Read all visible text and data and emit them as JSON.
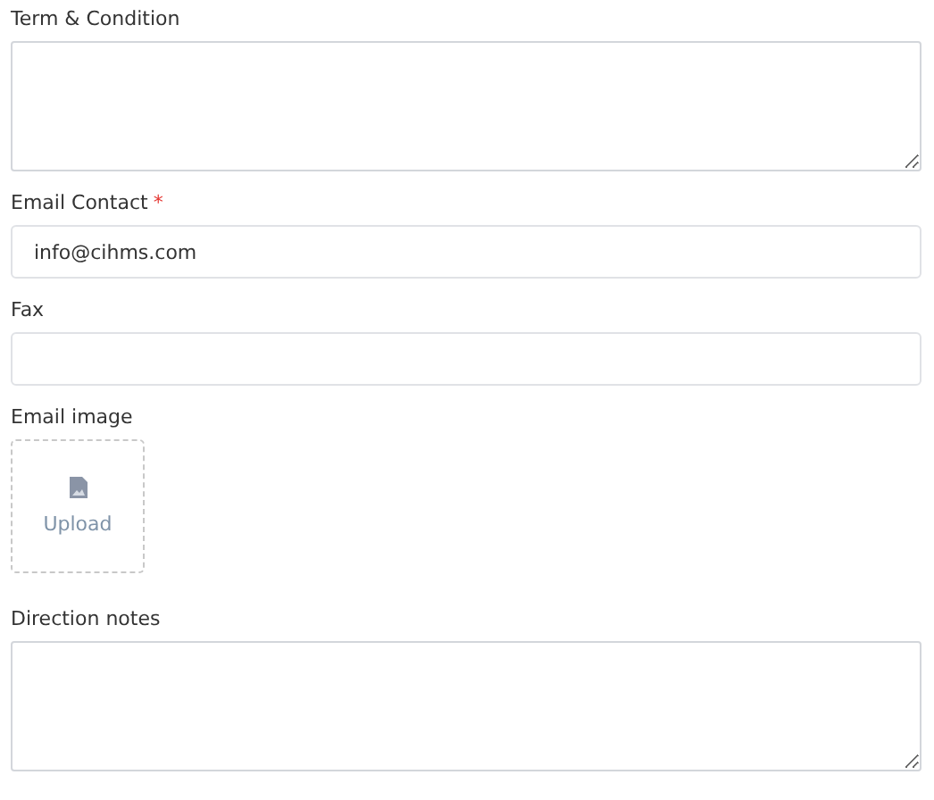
{
  "fields": [
    {
      "kind": "textarea",
      "label": "Term & Condition"
    },
    {
      "kind": "input",
      "label": "Email Contact",
      "required_mark": "*",
      "value": "info@cihms.com"
    },
    {
      "kind": "input",
      "label": "Fax"
    },
    {
      "kind": "upload",
      "label": "Email image",
      "button": "Upload"
    },
    {
      "kind": "textarea",
      "label": "Direction notes"
    }
  ]
}
